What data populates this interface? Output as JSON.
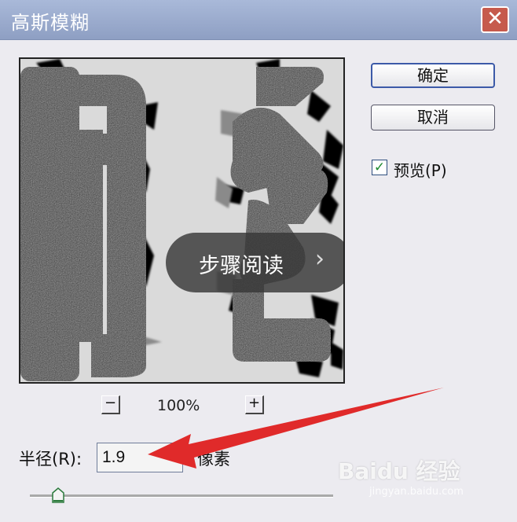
{
  "window": {
    "title": "高斯模糊",
    "close_glyph": "✕"
  },
  "buttons": {
    "ok_label": "确定",
    "cancel_label": "取消"
  },
  "preview_checkbox": {
    "checked": true,
    "check_glyph": "✓",
    "label": "预览(P)"
  },
  "zoom": {
    "out_label": "−",
    "level": "100%",
    "in_label": "+"
  },
  "radius": {
    "label": "半径(R):",
    "value": "1.9",
    "unit": "像素"
  },
  "overlay": {
    "label": "步骤阅读",
    "chevron": "›"
  },
  "watermark": {
    "text": "Baidu 经验",
    "sub": "jingyan.baidu.com"
  },
  "colors": {
    "arrow": "#e02a2a",
    "titlebar": "#9aaacf",
    "close": "#c65a4c",
    "checkmark": "#1e8a2e"
  }
}
